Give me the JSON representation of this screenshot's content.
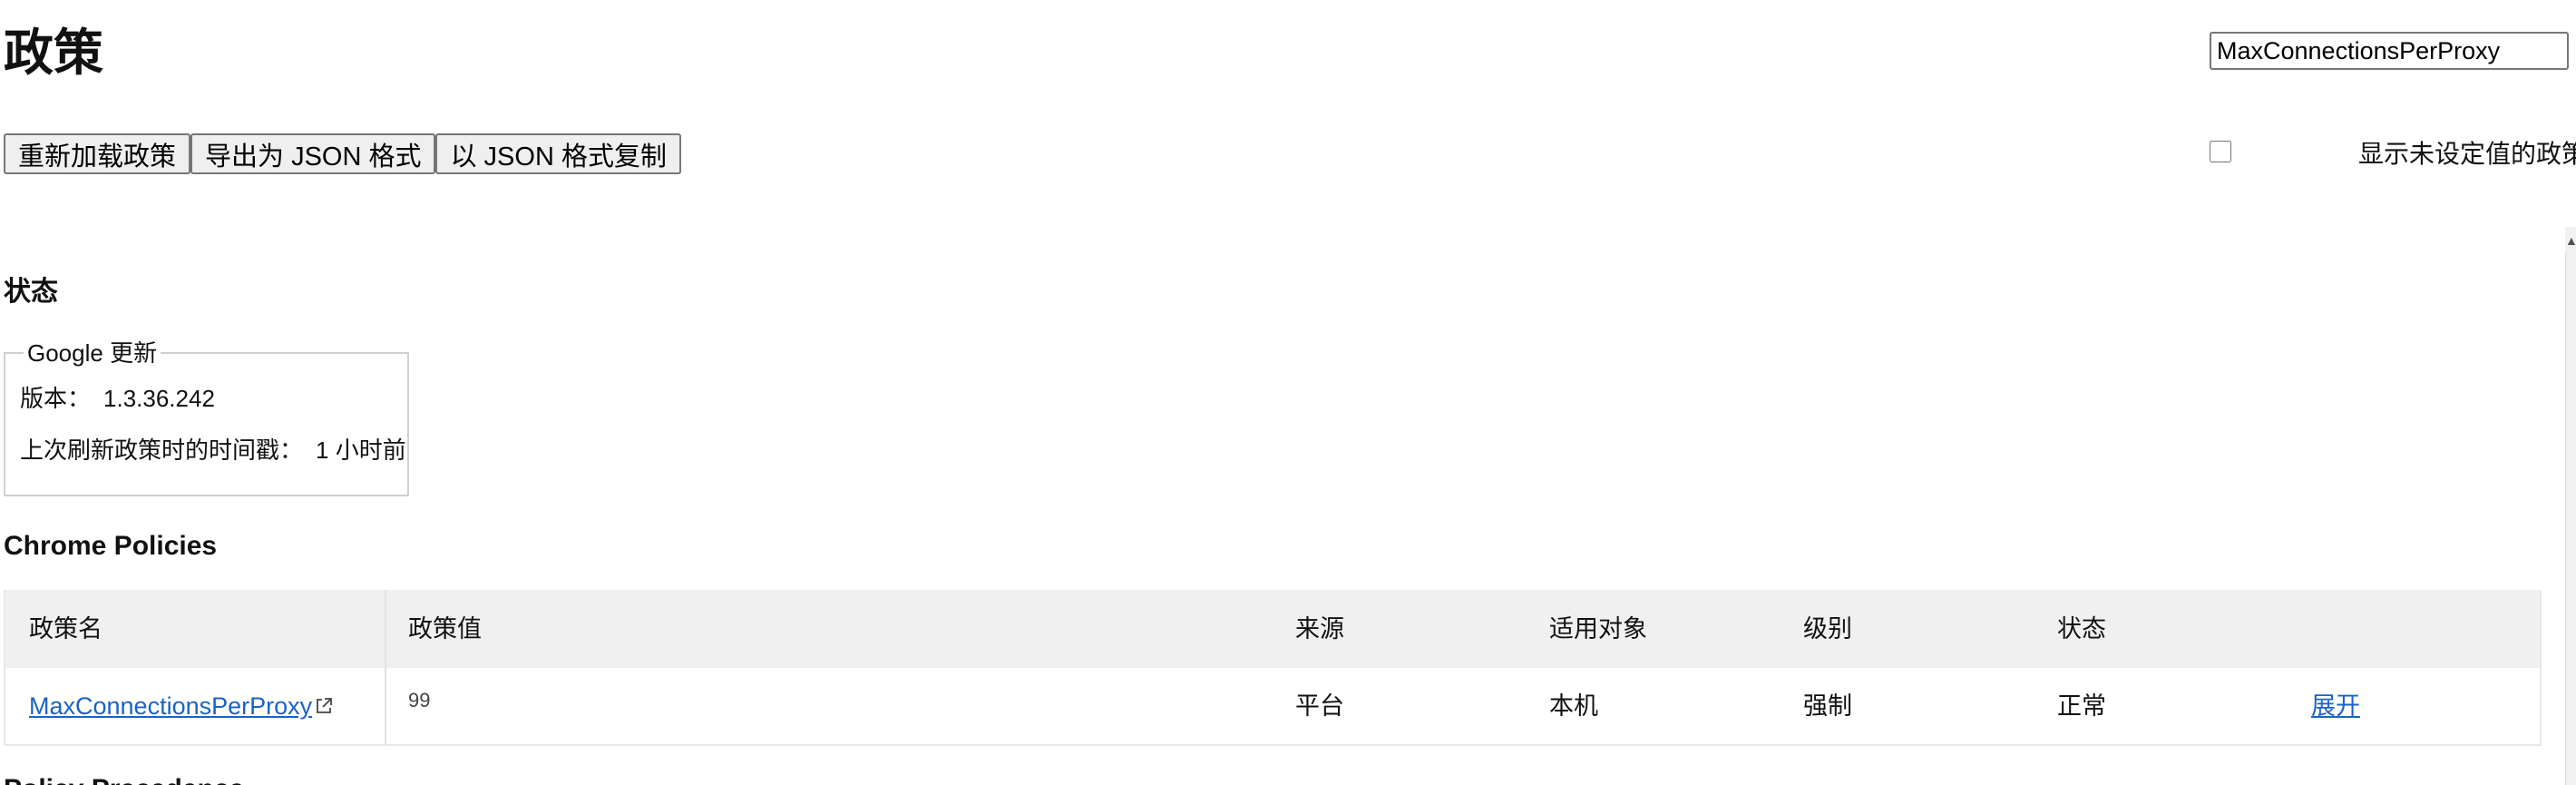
{
  "header": {
    "title": "政策",
    "search_value": "MaxConnectionsPerProxy"
  },
  "toolbar": {
    "reload_label": "重新加载政策",
    "export_label": "导出为 JSON 格式",
    "copy_label": "以 JSON 格式复制",
    "show_unset_label": "显示未设定值的政策",
    "show_unset_checked": false
  },
  "status": {
    "heading": "状态",
    "box_title": "Google 更新",
    "version_label": "版本：",
    "version_value": "1.3.36.242",
    "refresh_label": "上次刷新政策时的时间戳：",
    "refresh_value": "1 小时前"
  },
  "chrome_policies": {
    "heading": "Chrome Policies",
    "columns": {
      "name": "政策名",
      "value": "政策值",
      "source": "来源",
      "scope": "适用对象",
      "level": "级别",
      "status": "状态"
    },
    "rows": [
      {
        "name": "MaxConnectionsPerProxy",
        "value": "99",
        "source": "平台",
        "scope": "本机",
        "level": "强制",
        "status": "正常",
        "action": "展开"
      }
    ]
  },
  "next_section": {
    "heading": "Policy Precedence"
  },
  "colors": {
    "link": "#1a63c6",
    "header_bg": "#f0f0f0",
    "button_bg": "#efefef"
  },
  "icons": {
    "external_link": "external-link-icon"
  }
}
